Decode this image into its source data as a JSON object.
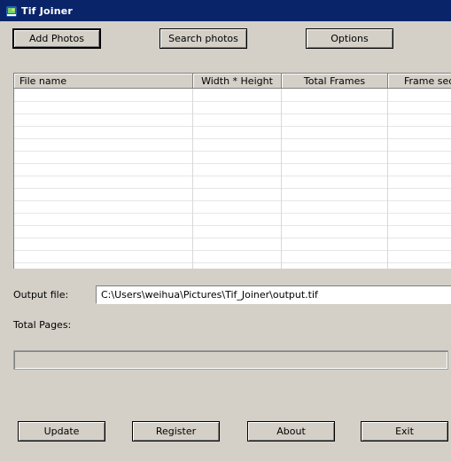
{
  "window": {
    "title": "Tif Joiner"
  },
  "toolbar": {
    "add_photos": "Add Photos",
    "search_photos": "Search photos",
    "options": "Options"
  },
  "file_list": {
    "columns": [
      "File name",
      "Width * Height",
      "Total Frames",
      "Frame sequence"
    ],
    "rows": []
  },
  "output": {
    "label": "Output file:",
    "value": "C:\\Users\\weihua\\Pictures\\Tif_Joiner\\output.tif"
  },
  "total_pages": {
    "label": "Total Pages:",
    "value": ""
  },
  "progress": {
    "value": 0
  },
  "footer": {
    "update": "Update",
    "register": "Register",
    "about": "About",
    "exit": "Exit"
  }
}
